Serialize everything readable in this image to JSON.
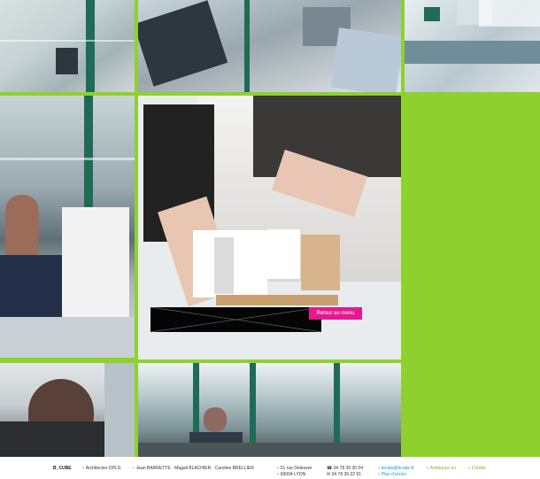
{
  "menu": {
    "back_label": "Retour au menu"
  },
  "footer": {
    "brand": "B_CUBE",
    "profession": "Architectes DPLG",
    "partners": "Jean BARRETTE · Magali BLACHIER · Caroline BRELLIER",
    "street": "51 rue Deleuvre",
    "city": "69004 LYON",
    "phone": "04 78 39 30 04",
    "fax": "04 78 39 22 91",
    "email": "bcube@bcube.fr",
    "ambiance": "Ambiance on",
    "credits": "Crédits",
    "plan": "Plan d'accès"
  },
  "colors": {
    "background_green": "#8ed12f",
    "accent_pink": "#e6188f",
    "link_cyan": "#159cd7",
    "link_green": "#78b830"
  },
  "icons": {
    "phone": "phone-icon",
    "fax": "fax-icon",
    "model": "architecture-model-icon"
  }
}
